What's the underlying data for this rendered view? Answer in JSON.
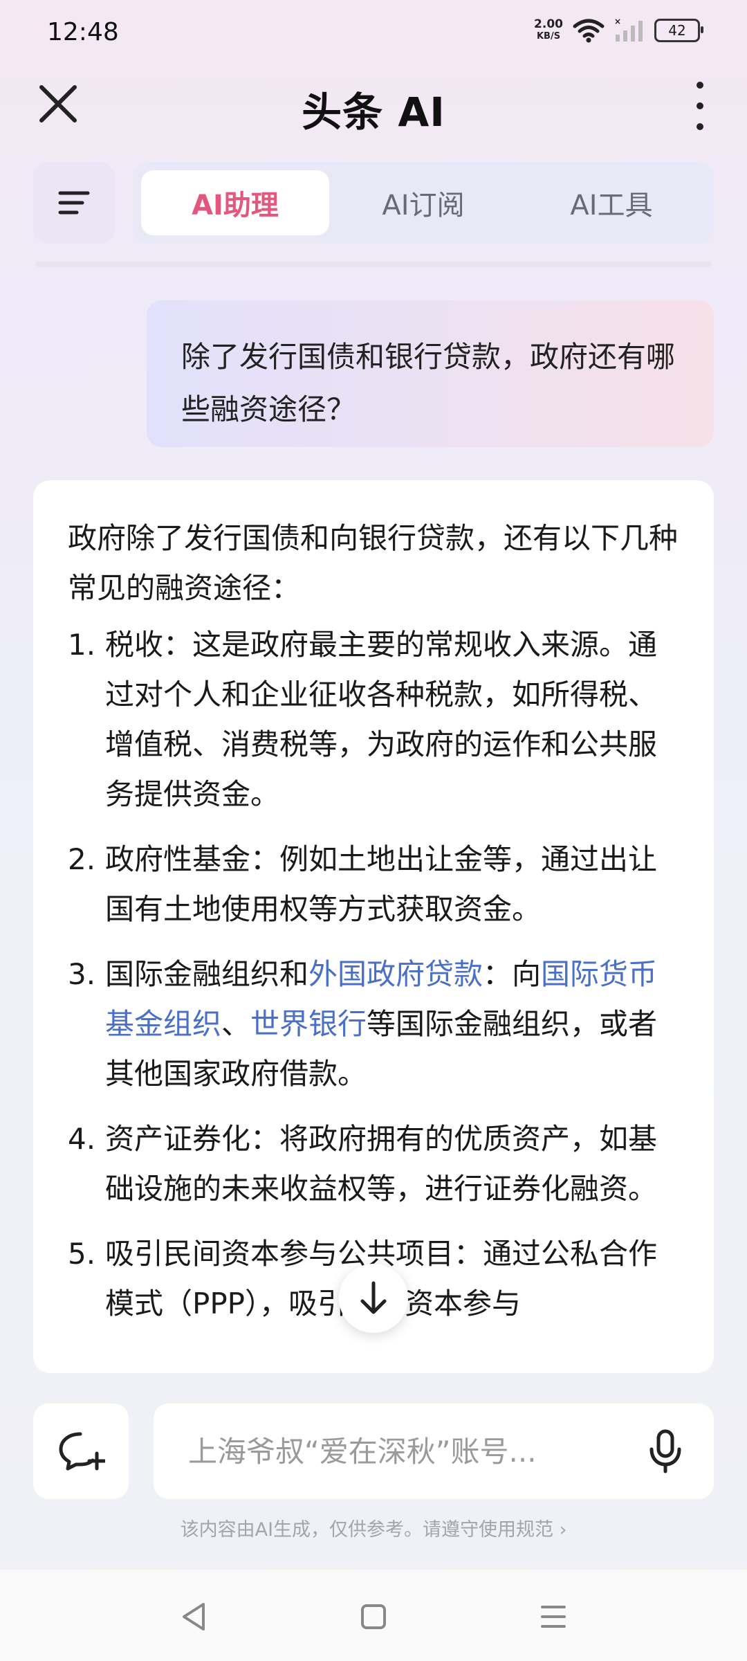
{
  "status_bar": {
    "time": "12:48",
    "net_speed_value": "2.00",
    "net_speed_unit": "KB/S",
    "battery": "42",
    "icons": [
      "wifi-icon",
      "signal-icon"
    ]
  },
  "header": {
    "title": "头条 AI",
    "close_icon": "close-icon",
    "more_icon": "more-vertical-icon"
  },
  "tabs": {
    "menu_icon": "menu-icon",
    "items": [
      {
        "label": "AI助理",
        "active": true
      },
      {
        "label": "AI订阅",
        "active": false
      },
      {
        "label": "AI工具",
        "active": false
      }
    ]
  },
  "conversation": {
    "user_message": "除了发行国债和银行贷款，政府还有哪些融资途径？",
    "answer": {
      "intro": "政府除了发行国债和向银行贷款，还有以下几种常见的融资途径：",
      "items": [
        {
          "num": "1.",
          "text": "税收：这是政府最主要的常规收入来源。通过对个人和企业征收各种税款，如所得税、增值税、消费税等，为政府的运作和公共服务提供资金。"
        },
        {
          "num": "2.",
          "text": "政府性基金：例如土地出让金等，通过出让国有土地使用权等方式获取资金。"
        },
        {
          "num": "3.",
          "part1": "国际金融组织和",
          "link1": "外国政府贷款",
          "part2": "：向",
          "link2": "国际货币基金组织",
          "part3": "、",
          "link3": "世界银行",
          "part4": "等国际金融组织，或者其他国家政府借款。"
        },
        {
          "num": "4.",
          "text": "资产证券化：将政府拥有的优质资产，如基础设施的未来收益权等，进行证券化融资。"
        },
        {
          "num": "5.",
          "text": "吸引民间资本参与公共项目：通过公私合作模式（PPP），吸引社会资本参与"
        }
      ]
    }
  },
  "input": {
    "placeholder": "上海爷叔“爱在深秋”账号...",
    "new_chat_icon": "new-chat-icon",
    "mic_icon": "microphone-icon"
  },
  "disclaimer": "该内容由AI生成，仅供参考。请遵守使用规范 ›",
  "nav_bar": {
    "icons": [
      "back-icon",
      "home-icon",
      "recents-icon"
    ]
  },
  "colors": {
    "accent": "#e3577e",
    "link": "#4a6fc7"
  }
}
